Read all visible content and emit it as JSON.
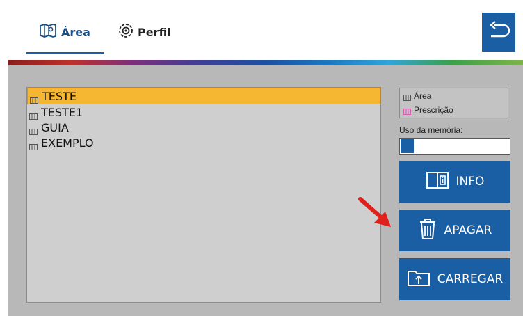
{
  "tabs": [
    {
      "label": "Área",
      "icon": "map-area-icon",
      "active": true
    },
    {
      "label": "Perfil",
      "icon": "profile-icon",
      "active": false
    }
  ],
  "back_button": {
    "icon": "return-arrow-icon"
  },
  "file_list": {
    "items": [
      {
        "label": "TESTE",
        "selected": true
      },
      {
        "label": "TESTE1",
        "selected": false
      },
      {
        "label": "GUIA",
        "selected": false
      },
      {
        "label": "EXEMPLO",
        "selected": false
      }
    ]
  },
  "legend": {
    "area_label": "Área",
    "prescription_label": "Prescrição"
  },
  "memory": {
    "label": "Uso da memória:",
    "usage_fraction": 0.12
  },
  "buttons": {
    "info_label": "INFO",
    "apagar_label": "APAGAR",
    "carregar_label": "CARREGAR"
  },
  "colors": {
    "accent_blue": "#1a5fa4",
    "selected_row": "#f5b731",
    "pointer_arrow": "#e0201b",
    "prescription_icon": "#d35bb0"
  }
}
